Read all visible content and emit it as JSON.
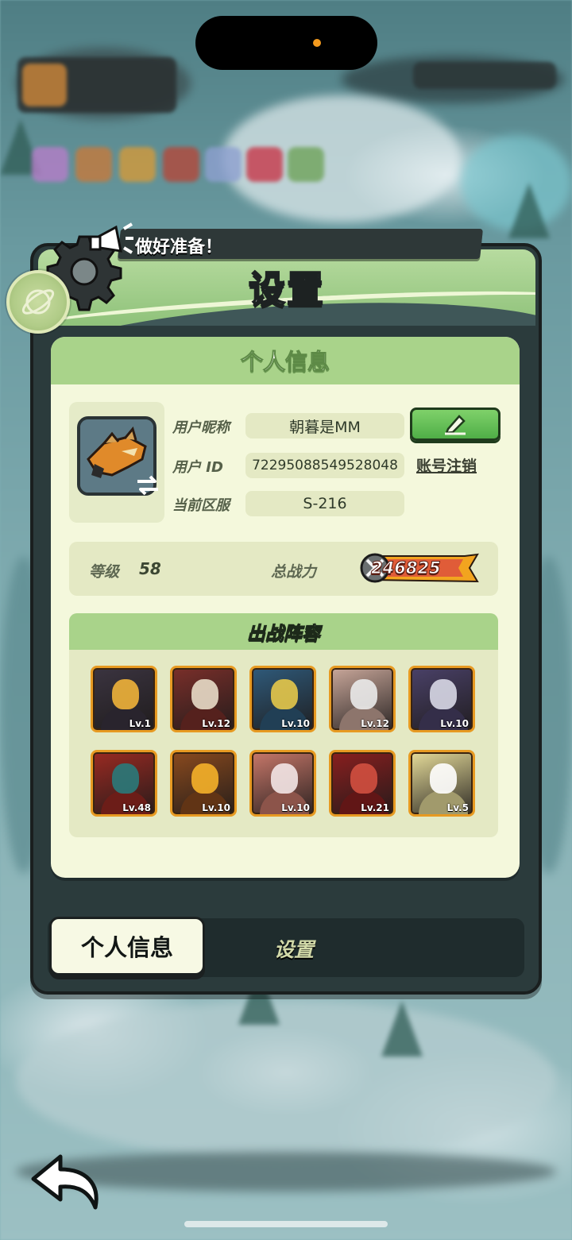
{
  "panel": {
    "title": "设置",
    "banner_text": "做好准备！"
  },
  "profile_card": {
    "header": "个人信息",
    "nickname_label": "用户昵称",
    "nickname_value": "朝暮是MM",
    "userid_label": "用户 ID",
    "userid_value": "72295088549528048",
    "server_label": "当前区服",
    "server_value": "S-216",
    "cancel_account_label": "账号注销",
    "level_label": "等级",
    "level_value": "58",
    "power_label": "总战力",
    "power_value": "246825"
  },
  "lineup": {
    "title": "出战阵容",
    "heroes": [
      {
        "level": "Lv.1",
        "color": "#3b3440",
        "accent": "#f0b23a"
      },
      {
        "level": "Lv.12",
        "color": "#7a2f2a",
        "accent": "#e8dcc8"
      },
      {
        "level": "Lv.10",
        "color": "#2f5a7a",
        "accent": "#e5c84a"
      },
      {
        "level": "Lv.12",
        "color": "#c9a79a",
        "accent": "#eaeaea"
      },
      {
        "level": "Lv.10",
        "color": "#4a4168",
        "accent": "#d8d8e6"
      },
      {
        "level": "Lv.48",
        "color": "#9a2a22",
        "accent": "#2a7a7a"
      },
      {
        "level": "Lv.10",
        "color": "#8a4a1e",
        "accent": "#f5b12a"
      },
      {
        "level": "Lv.10",
        "color": "#c8786a",
        "accent": "#f3e6e6"
      },
      {
        "level": "Lv.21",
        "color": "#8a1f1f",
        "accent": "#d25040"
      },
      {
        "level": "Lv.5",
        "color": "#e6dc9a",
        "accent": "#ffffff"
      }
    ]
  },
  "tabs": {
    "active_label": "个人信息",
    "inactive_label": "设置"
  },
  "colors": {
    "accent_green": "#a9d38a",
    "card_bg": "#f4f8dc",
    "panel_dark": "#2b3b3c",
    "gold": "#e79a22"
  }
}
